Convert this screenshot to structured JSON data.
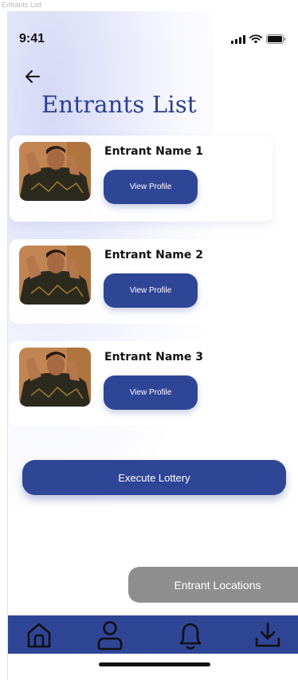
{
  "frame": {
    "label": "Entrants List"
  },
  "status_bar": {
    "time": "9:41",
    "icons": [
      "signal-icon",
      "wifi-icon",
      "battery-icon"
    ]
  },
  "header": {
    "back_icon": "arrow-left-icon",
    "title": "Entrants List"
  },
  "entrants": [
    {
      "name": "Entrant Name 1",
      "button_label": "View Profile"
    },
    {
      "name": "Entrant Name 2",
      "button_label": "View Profile"
    },
    {
      "name": "Entrant Name 3",
      "button_label": "View Profile"
    }
  ],
  "actions": {
    "execute_label": "Execute Lottery",
    "locations_label": "Entrant Locations"
  },
  "bottom_nav": {
    "items": [
      "home-icon",
      "profile-icon",
      "bell-icon",
      "download-icon"
    ]
  },
  "colors": {
    "primary": "#2f4596",
    "title": "#2d3f90",
    "secondary_button": "#8e8e8e"
  }
}
